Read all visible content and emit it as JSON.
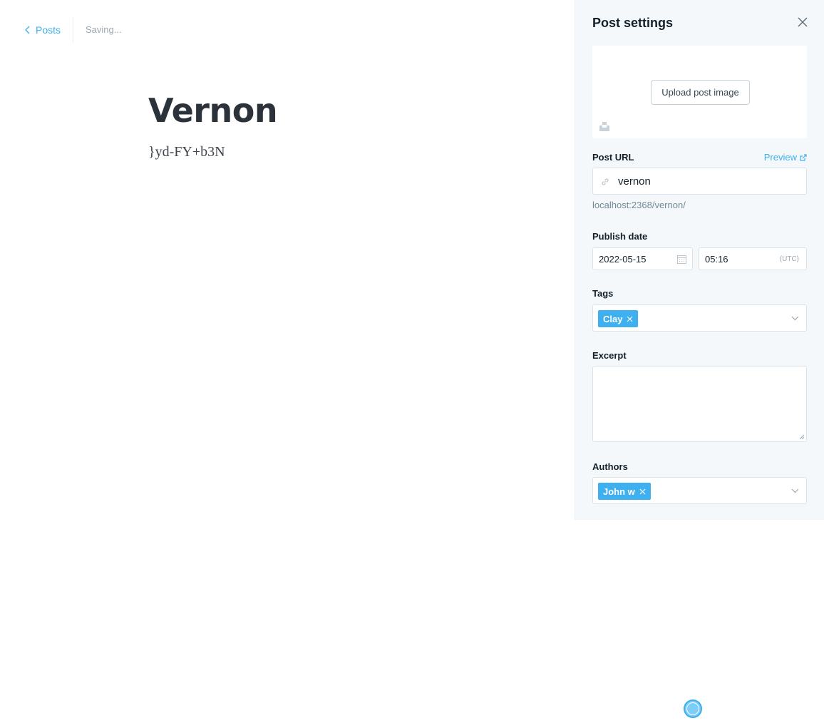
{
  "header": {
    "back_label": "Posts",
    "status": "Saving..."
  },
  "post": {
    "title": "Vernon",
    "body": "}yd-FY+b3N"
  },
  "settings": {
    "title": "Post settings",
    "upload_label": "Upload post image",
    "url": {
      "label": "Post URL",
      "preview_label": "Preview",
      "value": "vernon",
      "hint": "localhost:2368/vernon/"
    },
    "publish": {
      "label": "Publish date",
      "date": "2022-05-15",
      "time": "05:16",
      "timezone": "(UTC)"
    },
    "tags": {
      "label": "Tags",
      "items": [
        "Clay"
      ]
    },
    "excerpt": {
      "label": "Excerpt",
      "value": ""
    },
    "authors": {
      "label": "Authors",
      "items": [
        "John w"
      ]
    }
  },
  "colors": {
    "accent": "#3eb0ef",
    "panel_bg": "#f4f8fb",
    "text": "#15212a",
    "muted": "#738a94"
  },
  "icons": [
    "chevron-left-icon",
    "close-icon",
    "unsplash-icon",
    "external-link-icon",
    "link-icon",
    "calendar-icon",
    "chevron-down-icon",
    "remove-chip-icon"
  ]
}
